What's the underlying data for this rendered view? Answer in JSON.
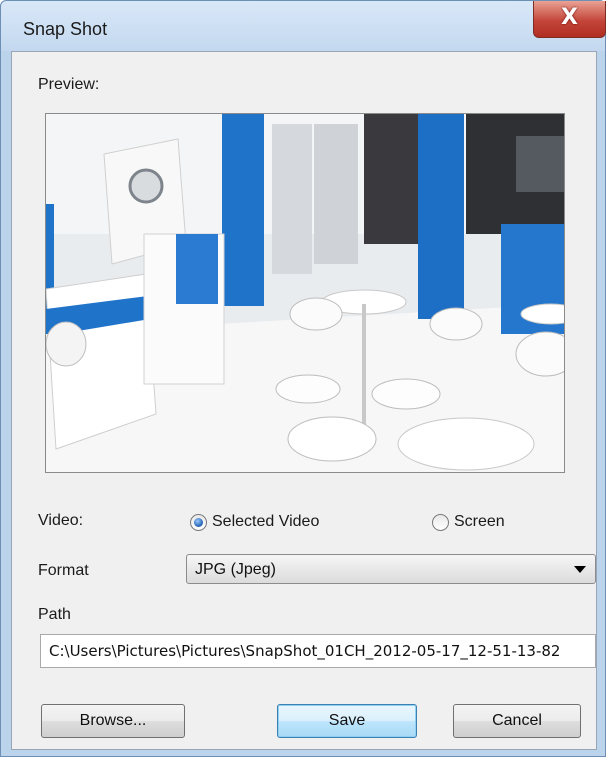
{
  "window": {
    "title": "Snap Shot",
    "close_label": "X"
  },
  "preview": {
    "label": "Preview:",
    "image_alt": "camera snapshot preview"
  },
  "video": {
    "label": "Video:",
    "options": [
      {
        "label": "Selected Video",
        "selected": true
      },
      {
        "label": "Screen",
        "selected": false
      }
    ]
  },
  "format": {
    "label": "Format",
    "selected": "JPG (Jpeg)"
  },
  "path": {
    "label": "Path",
    "value": "C:\\Users\\Pictures\\Pictures\\SnapShot_01CH_2012-05-17_12-51-13-82"
  },
  "buttons": {
    "browse": "Browse...",
    "save": "Save",
    "cancel": "Cancel"
  },
  "colors": {
    "accent": "#1f73c9",
    "title_bar": "#c3d8ef",
    "close": "#c4453a"
  }
}
